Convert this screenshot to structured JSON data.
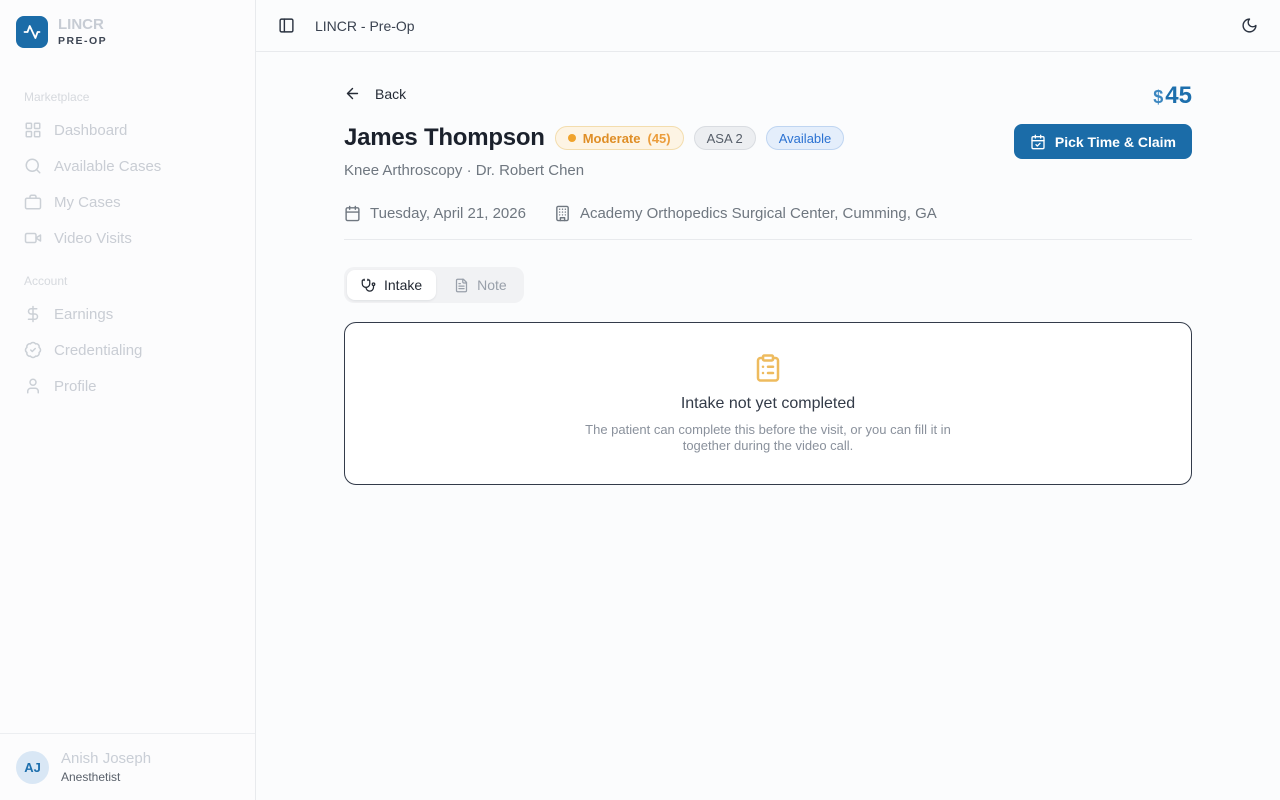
{
  "brand": {
    "name": "LINCR",
    "subtitle": "PRE-OP",
    "accent_color": "#1b6ca8"
  },
  "sidebar": {
    "sections": [
      {
        "label": "Marketplace",
        "items": [
          {
            "label": "Dashboard",
            "icon": "dashboard-icon"
          },
          {
            "label": "Available Cases",
            "icon": "search-icon"
          },
          {
            "label": "My Cases",
            "icon": "briefcase-icon"
          },
          {
            "label": "Video Visits",
            "icon": "video-icon"
          }
        ]
      },
      {
        "label": "Account",
        "items": [
          {
            "label": "Earnings",
            "icon": "dollar-icon"
          },
          {
            "label": "Credentialing",
            "icon": "badge-check-icon"
          },
          {
            "label": "Profile",
            "icon": "user-icon"
          }
        ]
      }
    ],
    "user": {
      "initials": "AJ",
      "name": "Anish Joseph",
      "role": "Anesthetist"
    }
  },
  "topbar": {
    "title": "LINCR - Pre-Op"
  },
  "case": {
    "back_label": "Back",
    "patient_name": "James Thompson",
    "risk_badge": {
      "label": "Moderate",
      "count": "(45)",
      "color": "#df8e26"
    },
    "asa_badge": "ASA 2",
    "status_badge": "Available",
    "procedure_line": "Knee Arthroscopy · Dr. Robert Chen",
    "price": {
      "currency": "$",
      "amount": "45"
    },
    "claim_button_label": "Pick Time & Claim",
    "date": "Tuesday, April 21, 2026",
    "location": "Academy Orthopedics Surgical Center, Cumming, GA",
    "tabs": [
      {
        "label": "Intake",
        "icon": "stethoscope-icon",
        "active": true
      },
      {
        "label": "Note",
        "icon": "file-text-icon",
        "active": false
      }
    ],
    "intake_empty": {
      "icon": "clipboard-list-icon",
      "icon_color": "#eebb5e",
      "title": "Intake not yet completed",
      "description": "The patient can complete this before the visit, or you can fill it in together during the video call."
    }
  }
}
